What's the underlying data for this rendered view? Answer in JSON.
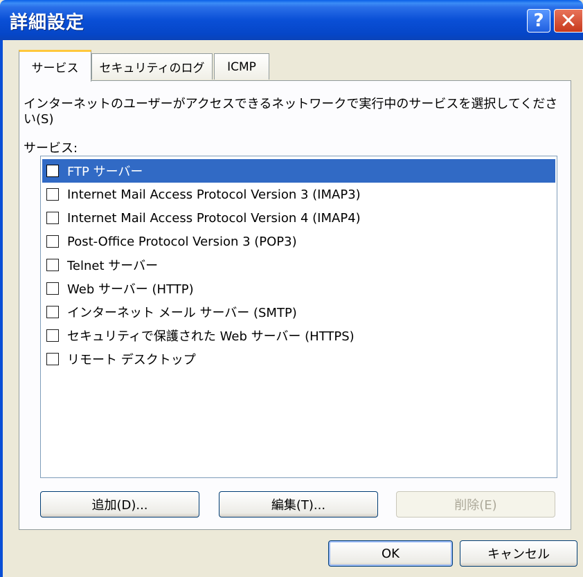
{
  "window": {
    "title": "詳細設定"
  },
  "titlebar": {
    "help_glyph": "?",
    "close_glyph": "✕"
  },
  "tabs": [
    {
      "label": "サービス",
      "active": true
    },
    {
      "label": "セキュリティのログ",
      "active": false
    },
    {
      "label": "ICMP",
      "active": false
    }
  ],
  "panel": {
    "description": "インターネットのユーザーがアクセスできるネットワークで実行中のサービスを選択してください(S)",
    "services_label": "サービス:",
    "services": [
      {
        "label": "FTP サーバー",
        "checked": false,
        "selected": true
      },
      {
        "label": "Internet Mail Access Protocol Version 3 (IMAP3)",
        "checked": false,
        "selected": false
      },
      {
        "label": "Internet Mail Access Protocol Version 4 (IMAP4)",
        "checked": false,
        "selected": false
      },
      {
        "label": "Post-Office Protocol Version 3 (POP3)",
        "checked": false,
        "selected": false
      },
      {
        "label": "Telnet サーバー",
        "checked": false,
        "selected": false
      },
      {
        "label": "Web サーバー (HTTP)",
        "checked": false,
        "selected": false
      },
      {
        "label": "インターネット メール サーバー (SMTP)",
        "checked": false,
        "selected": false
      },
      {
        "label": "セキュリティで保護された Web サーバー (HTTPS)",
        "checked": false,
        "selected": false
      },
      {
        "label": "リモート デスクトップ",
        "checked": false,
        "selected": false
      }
    ],
    "buttons": {
      "add": "追加(D)...",
      "edit": "編集(T)...",
      "delete": "削除(E)"
    }
  },
  "footer": {
    "ok": "OK",
    "cancel": "キャンセル"
  },
  "colors": {
    "selection": "#316ac5",
    "titlebar": "#0a4fd6",
    "tab_highlight": "#ffc83c"
  }
}
